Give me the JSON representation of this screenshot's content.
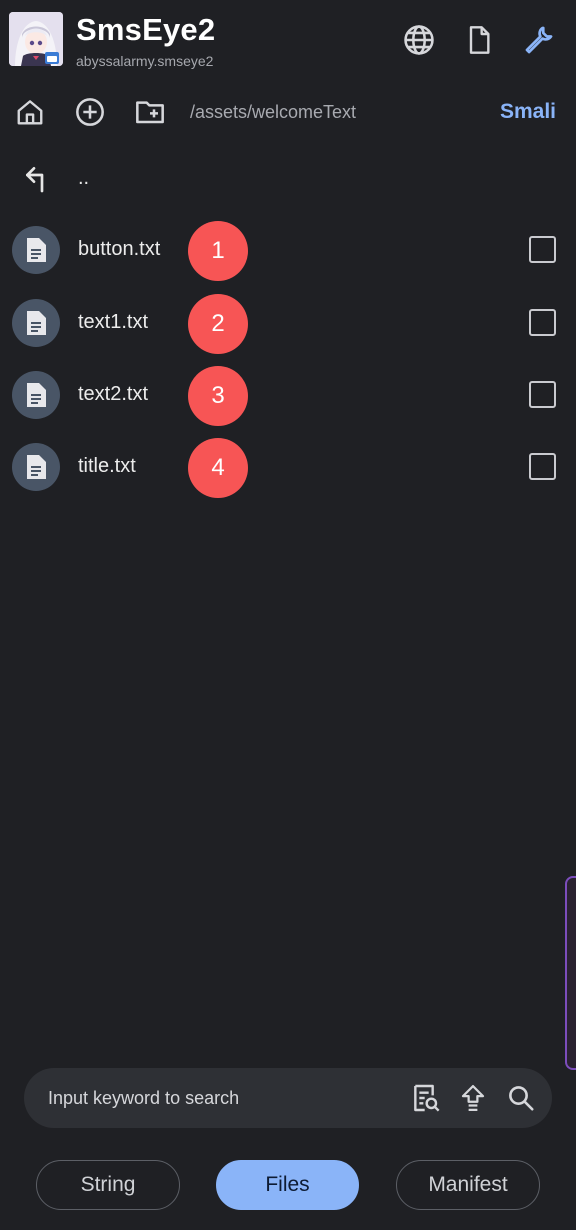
{
  "header": {
    "title": "SmsEye2",
    "package": "abyssalarmy.smseye2",
    "icons": [
      "globe-icon",
      "file-icon",
      "wrench-icon"
    ],
    "accent": "#8ab4f8"
  },
  "toolbar": {
    "path": "/assets/welcomeText",
    "smali_label": "Smali",
    "icons": [
      "home-icon",
      "add-circle-icon",
      "new-folder-icon"
    ]
  },
  "parent": {
    "label": ".."
  },
  "files": [
    {
      "name": "button.txt",
      "badge": "1"
    },
    {
      "name": "text1.txt",
      "badge": "2"
    },
    {
      "name": "text2.txt",
      "badge": "3"
    },
    {
      "name": "title.txt",
      "badge": "4"
    }
  ],
  "search": {
    "placeholder": "Input keyword to search",
    "icons": [
      "find-in-page-icon",
      "upload-icon",
      "search-icon"
    ]
  },
  "tabs": [
    {
      "label": "String",
      "active": false
    },
    {
      "label": "Files",
      "active": true
    },
    {
      "label": "Manifest",
      "active": false
    }
  ],
  "colors": {
    "background": "#1f2024",
    "badge": "#f75555",
    "file_icon_bg": "#495566",
    "active_tab": "#8ab4f8"
  }
}
